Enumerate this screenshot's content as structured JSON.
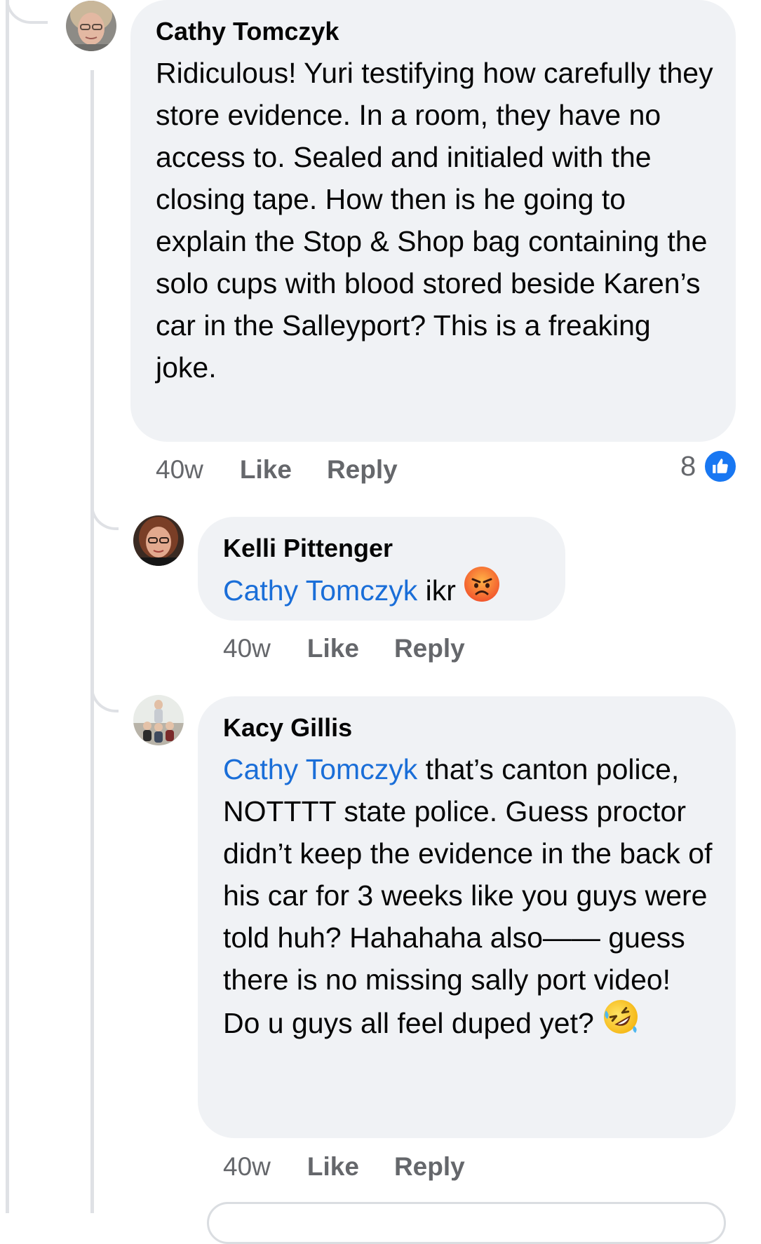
{
  "comments": [
    {
      "author": "Cathy Tomczyk",
      "mention": "",
      "text": "Ridiculous! Yuri testifying how carefully they store evidence. In a room, they have no access to. Sealed and initialed with the closing tape. How then is he going to explain the Stop & Shop bag containing the solo cups with blood stored beside Karen’s car in the Salleyport? This is a freaking joke.",
      "emoji": "",
      "time": "40w",
      "like_label": "Like",
      "reply_label": "Reply",
      "reaction_count": "8",
      "reaction_icon": "like-icon"
    },
    {
      "author": "Kelli Pittenger",
      "mention": "Cathy Tomczyk",
      "text": "ikr",
      "emoji": "angry-face-emoji",
      "time": "40w",
      "like_label": "Like",
      "reply_label": "Reply"
    },
    {
      "author": "Kacy Gillis",
      "mention": "Cathy Tomczyk",
      "text": "that’s canton police, NOTTTT state police. Guess proctor didn’t keep the evidence in the back of his car for 3 weeks like you guys were told huh? Hahahaha also—— guess there is no missing sally port video! Do u guys all feel duped yet?",
      "emoji": "rolling-on-floor-laughing-emoji",
      "time": "40w",
      "like_label": "Like",
      "reply_label": "Reply"
    }
  ],
  "colors": {
    "bubble": "#f0f2f5",
    "mention": "#1a6ed8",
    "meta": "#65676b",
    "like_badge": "#1877f2",
    "thread_line": "#dfe1e5"
  }
}
